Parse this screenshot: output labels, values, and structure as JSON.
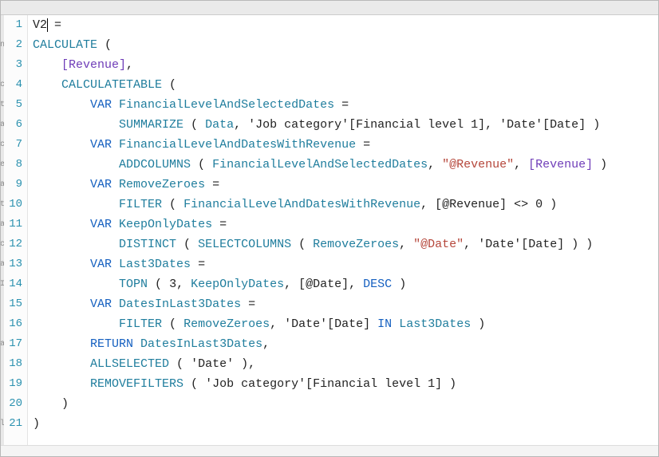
{
  "editor": {
    "measure_name": "V2",
    "assign_op": " = ",
    "cursor_line": 1,
    "cursor_after": "V2"
  },
  "line_numbers": [
    "1",
    "2",
    "3",
    "4",
    "5",
    "6",
    "7",
    "8",
    "9",
    "10",
    "11",
    "12",
    "13",
    "14",
    "15",
    "16",
    "17",
    "18",
    "19",
    "20",
    "21"
  ],
  "gutter_bg_chars": [
    "",
    "n",
    "",
    "ic",
    "ht",
    "a",
    "ic",
    "e",
    "a",
    "ht",
    "a",
    "ic",
    "a",
    "I",
    "",
    "",
    "a",
    "",
    "",
    "",
    "l"
  ],
  "code": {
    "lines": [
      [
        {
          "t": "V2",
          "c": "op"
        },
        {
          "t": " = ",
          "c": "op"
        }
      ],
      [
        {
          "t": "CALCULATE",
          "c": "kw-calc"
        },
        {
          "t": " (",
          "c": "op"
        }
      ],
      [
        {
          "t": "    ",
          "c": "op"
        },
        {
          "t": "[Revenue]",
          "c": "measure"
        },
        {
          "t": ",",
          "c": "op"
        }
      ],
      [
        {
          "t": "    ",
          "c": "op"
        },
        {
          "t": "CALCULATETABLE",
          "c": "kw-calc"
        },
        {
          "t": " (",
          "c": "op"
        }
      ],
      [
        {
          "t": "        ",
          "c": "op"
        },
        {
          "t": "VAR",
          "c": "kw-var"
        },
        {
          "t": " ",
          "c": "op"
        },
        {
          "t": "FinancialLevelAndSelectedDates",
          "c": "ident"
        },
        {
          "t": " =",
          "c": "op"
        }
      ],
      [
        {
          "t": "            ",
          "c": "op"
        },
        {
          "t": "SUMMARIZE",
          "c": "fn"
        },
        {
          "t": " ( ",
          "c": "op"
        },
        {
          "t": "Data",
          "c": "tbl"
        },
        {
          "t": ", ",
          "c": "op"
        },
        {
          "t": "'Job category'[Financial level 1]",
          "c": "col"
        },
        {
          "t": ", ",
          "c": "op"
        },
        {
          "t": "'Date'[Date]",
          "c": "col"
        },
        {
          "t": " )",
          "c": "op"
        }
      ],
      [
        {
          "t": "        ",
          "c": "op"
        },
        {
          "t": "VAR",
          "c": "kw-var"
        },
        {
          "t": " ",
          "c": "op"
        },
        {
          "t": "FinancialLevelAndDatesWithRevenue",
          "c": "ident"
        },
        {
          "t": " =",
          "c": "op"
        }
      ],
      [
        {
          "t": "            ",
          "c": "op"
        },
        {
          "t": "ADDCOLUMNS",
          "c": "fn"
        },
        {
          "t": " ( ",
          "c": "op"
        },
        {
          "t": "FinancialLevelAndSelectedDates",
          "c": "ident"
        },
        {
          "t": ", ",
          "c": "op"
        },
        {
          "t": "\"@Revenue\"",
          "c": "str"
        },
        {
          "t": ", ",
          "c": "op"
        },
        {
          "t": "[Revenue]",
          "c": "measure"
        },
        {
          "t": " )",
          "c": "op"
        }
      ],
      [
        {
          "t": "        ",
          "c": "op"
        },
        {
          "t": "VAR",
          "c": "kw-var"
        },
        {
          "t": " ",
          "c": "op"
        },
        {
          "t": "RemoveZeroes",
          "c": "ident"
        },
        {
          "t": " =",
          "c": "op"
        }
      ],
      [
        {
          "t": "            ",
          "c": "op"
        },
        {
          "t": "FILTER",
          "c": "fn"
        },
        {
          "t": " ( ",
          "c": "op"
        },
        {
          "t": "FinancialLevelAndDatesWithRevenue",
          "c": "ident"
        },
        {
          "t": ", ",
          "c": "op"
        },
        {
          "t": "[@Revenue]",
          "c": "col"
        },
        {
          "t": " <> ",
          "c": "op"
        },
        {
          "t": "0",
          "c": "num"
        },
        {
          "t": " )",
          "c": "op"
        }
      ],
      [
        {
          "t": "        ",
          "c": "op"
        },
        {
          "t": "VAR",
          "c": "kw-var"
        },
        {
          "t": " ",
          "c": "op"
        },
        {
          "t": "KeepOnlyDates",
          "c": "ident"
        },
        {
          "t": " =",
          "c": "op"
        }
      ],
      [
        {
          "t": "            ",
          "c": "op"
        },
        {
          "t": "DISTINCT",
          "c": "fn"
        },
        {
          "t": " ( ",
          "c": "op"
        },
        {
          "t": "SELECTCOLUMNS",
          "c": "fn"
        },
        {
          "t": " ( ",
          "c": "op"
        },
        {
          "t": "RemoveZeroes",
          "c": "ident"
        },
        {
          "t": ", ",
          "c": "op"
        },
        {
          "t": "\"@Date\"",
          "c": "str"
        },
        {
          "t": ", ",
          "c": "op"
        },
        {
          "t": "'Date'[Date]",
          "c": "col"
        },
        {
          "t": " ) )",
          "c": "op"
        }
      ],
      [
        {
          "t": "        ",
          "c": "op"
        },
        {
          "t": "VAR",
          "c": "kw-var"
        },
        {
          "t": " ",
          "c": "op"
        },
        {
          "t": "Last3Dates",
          "c": "ident"
        },
        {
          "t": " =",
          "c": "op"
        }
      ],
      [
        {
          "t": "            ",
          "c": "op"
        },
        {
          "t": "TOPN",
          "c": "fn"
        },
        {
          "t": " ( ",
          "c": "op"
        },
        {
          "t": "3",
          "c": "num"
        },
        {
          "t": ", ",
          "c": "op"
        },
        {
          "t": "KeepOnlyDates",
          "c": "ident"
        },
        {
          "t": ", ",
          "c": "op"
        },
        {
          "t": "[@Date]",
          "c": "col"
        },
        {
          "t": ", ",
          "c": "op"
        },
        {
          "t": "DESC",
          "c": "kw-var"
        },
        {
          "t": " )",
          "c": "op"
        }
      ],
      [
        {
          "t": "        ",
          "c": "op"
        },
        {
          "t": "VAR",
          "c": "kw-var"
        },
        {
          "t": " ",
          "c": "op"
        },
        {
          "t": "DatesInLast3Dates",
          "c": "ident"
        },
        {
          "t": " =",
          "c": "op"
        }
      ],
      [
        {
          "t": "            ",
          "c": "op"
        },
        {
          "t": "FILTER",
          "c": "fn"
        },
        {
          "t": " ( ",
          "c": "op"
        },
        {
          "t": "RemoveZeroes",
          "c": "ident"
        },
        {
          "t": ", ",
          "c": "op"
        },
        {
          "t": "'Date'[Date]",
          "c": "col"
        },
        {
          "t": " ",
          "c": "op"
        },
        {
          "t": "IN",
          "c": "kw-var"
        },
        {
          "t": " ",
          "c": "op"
        },
        {
          "t": "Last3Dates",
          "c": "ident"
        },
        {
          "t": " )",
          "c": "op"
        }
      ],
      [
        {
          "t": "        ",
          "c": "op"
        },
        {
          "t": "RETURN",
          "c": "kw-var"
        },
        {
          "t": " ",
          "c": "op"
        },
        {
          "t": "DatesInLast3Dates",
          "c": "ident"
        },
        {
          "t": ",",
          "c": "op"
        }
      ],
      [
        {
          "t": "        ",
          "c": "op"
        },
        {
          "t": "ALLSELECTED",
          "c": "fn"
        },
        {
          "t": " ( ",
          "c": "op"
        },
        {
          "t": "'Date'",
          "c": "col"
        },
        {
          "t": " ),",
          "c": "op"
        }
      ],
      [
        {
          "t": "        ",
          "c": "op"
        },
        {
          "t": "REMOVEFILTERS",
          "c": "fn"
        },
        {
          "t": " ( ",
          "c": "op"
        },
        {
          "t": "'Job category'[Financial level 1]",
          "c": "col"
        },
        {
          "t": " )",
          "c": "op"
        }
      ],
      [
        {
          "t": "    )",
          "c": "op"
        }
      ],
      [
        {
          "t": ")",
          "c": "op"
        }
      ]
    ]
  },
  "footer_smudge": ""
}
